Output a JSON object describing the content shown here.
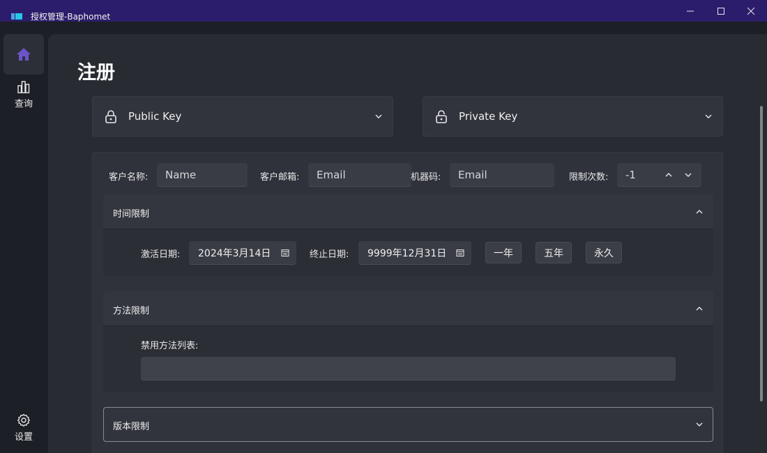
{
  "window": {
    "title": "授权管理-Baphomet",
    "buttons": [
      "minimize",
      "maximize",
      "close"
    ]
  },
  "sidebar": {
    "items": [
      {
        "name": "home",
        "icon": "home-icon",
        "label": ""
      },
      {
        "name": "query",
        "icon": "bar-chart-icon",
        "label": "查询"
      },
      {
        "name": "settings",
        "icon": "gear-icon",
        "label": "设置"
      }
    ]
  },
  "page": {
    "title": "注册"
  },
  "keys": {
    "public_label": "Public Key",
    "private_label": "Private Key"
  },
  "form": {
    "customer_name_label": "客户名称:",
    "customer_name_placeholder": "Name",
    "customer_email_label": "客户邮箱:",
    "customer_email_placeholder": "Email",
    "machine_code_label": "机器码:",
    "machine_code_placeholder": "Email",
    "limit_count_label": "限制次数:",
    "limit_count_value": "-1"
  },
  "time_limit": {
    "title": "时间限制",
    "activation_label": "激活日期:",
    "activation_value": "2024年3月14日",
    "end_label": "终止日期:",
    "end_value": "9999年12月31日",
    "buttons": [
      "一年",
      "五年",
      "永久"
    ]
  },
  "method_limit": {
    "title": "方法限制",
    "list_label": "禁用方法列表:",
    "list_value": ""
  },
  "version_limit": {
    "title": "版本限制"
  },
  "colors": {
    "titlebar": "#2b1d6b",
    "background": "#1c1f25",
    "panel": "#282b32",
    "card": "#31343c",
    "accent_home": "#6b54c8"
  }
}
